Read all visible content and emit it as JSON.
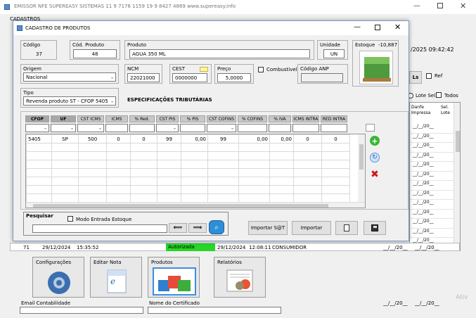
{
  "main_window": {
    "title": "EMISSOR NFE  SUPEREASY SISTEMAS     11 9 7176 1159      19 9 8427 4869       www.supereasy.info",
    "menu_cadastros": "CADASTROS",
    "datetime": "/2025 09:42:42",
    "badge_ls": "Ls",
    "chk_ref": "Ref",
    "chk_lote_sel": "Lote Sel.",
    "chk_todos": "Todos",
    "col_danfe": "Danfe Impressa",
    "col_sel": "Sel. Lote",
    "danfe_blank": "__/__/20__",
    "row": {
      "num": "71",
      "date1": "29/12/2024",
      "time1": "15:35:52",
      "status": "Autorizada",
      "date2": "29/12/2024",
      "time2": "12:08:11",
      "client": "CONSUMIDOR"
    },
    "menu_buttons": [
      "Configurações",
      "Editar Nota",
      "Produtos",
      "Relatórios"
    ],
    "email_label": "Email Contabilidade",
    "cert_label": "Nome do Certificado",
    "watermark": "Ativ"
  },
  "dialog": {
    "title": "CADASTRO DE PRODUTOS",
    "codigo_label": "Código",
    "codigo_value": "37",
    "cod_produto_label": "Cód. Produto",
    "cod_produto_value": "48",
    "produto_label": "Produto",
    "produto_value": "AGUA 350 ML",
    "unidade_label": "Unidade",
    "unidade_value": "UN",
    "estoque_label": "Estoque",
    "estoque_value": "-10,887",
    "origem_label": "Origem",
    "origem_value": "Nacional",
    "ncm_label": "NCM",
    "ncm_value": "22021000",
    "cest_label": "CEST",
    "cest_value": "0000000",
    "preco_label": "Preço",
    "preco_value": "5,0000",
    "combustivel_label": "Combustivel",
    "codigo_anp_label": "Código ANP",
    "tipo_label": "Tipo",
    "tipo_value": "Revenda produto ST - CFOP 5405",
    "especificacoes": "ESPECIFICAÇÕES TRIBUTÁRIAS",
    "tax_headers": [
      "CFOP",
      "UF",
      "CST ICMS",
      "ICMS",
      "% Red.",
      "CST PIS",
      "% PIS",
      "CST COFINS",
      "% COFINS",
      "% IVA",
      "ICMS INTRA",
      "RED INTRA"
    ],
    "tax_row": [
      "5405",
      "SP",
      "500",
      "0",
      "0",
      "99",
      "0,00",
      "99",
      "0,00",
      "0,00",
      "0",
      "0"
    ],
    "pesquisar_label": "Pesquisar",
    "modo_entrada": "Modo Entrada  Estoque",
    "importar_sat": "Importar S@T",
    "importar": "Importar"
  }
}
